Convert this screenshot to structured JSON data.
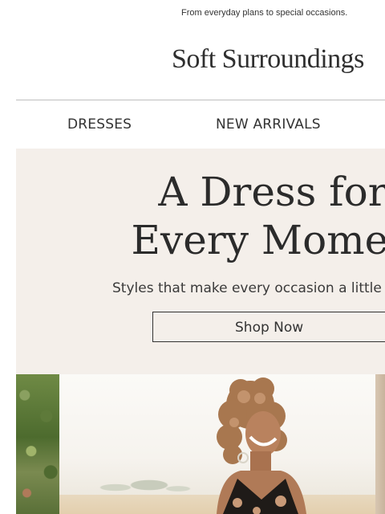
{
  "preheader": {
    "text": "From everyday plans to special occasions."
  },
  "brand": {
    "logo_text": "Soft Surroundings"
  },
  "nav": {
    "items": [
      {
        "label": "DRESSES"
      },
      {
        "label": "NEW ARRIVALS"
      }
    ]
  },
  "hero": {
    "title_line1": "A Dress for",
    "title_line2": "Every Momen",
    "subtitle": "Styles that make every occasion a little",
    "cta_label": "Shop Now",
    "background_color": "#f4efea"
  },
  "photo": {
    "description_icon": "model-photo"
  }
}
